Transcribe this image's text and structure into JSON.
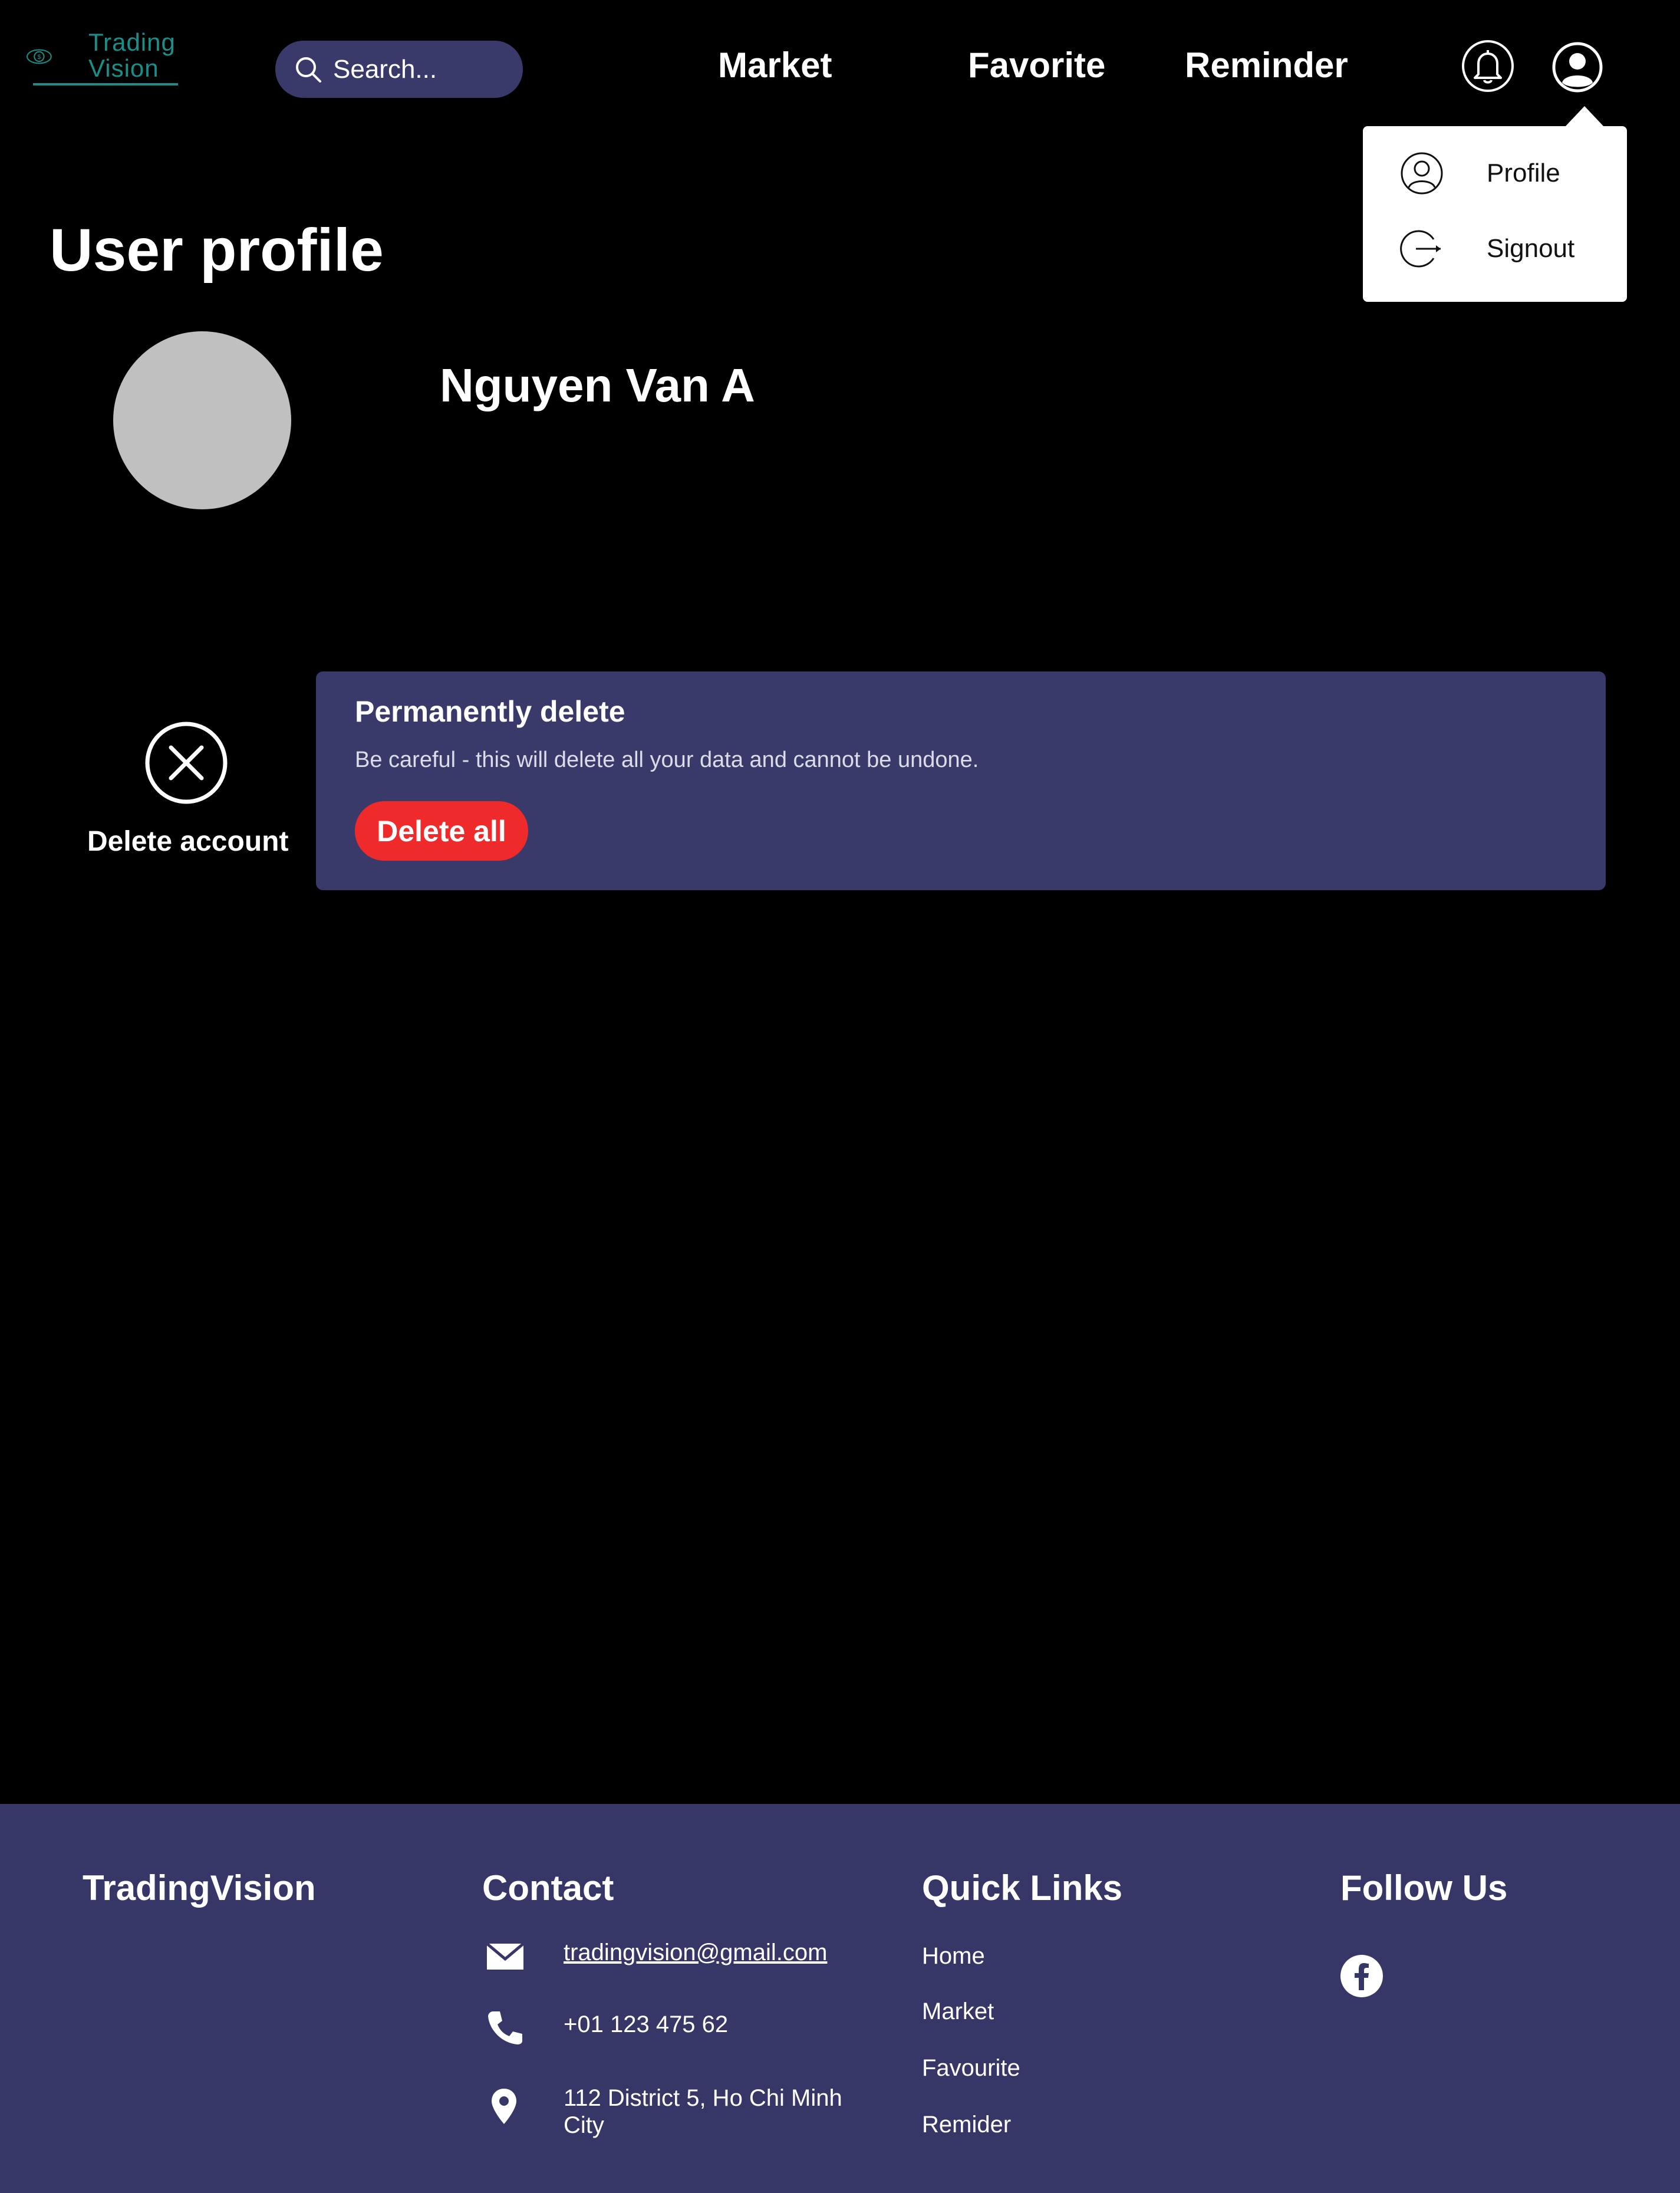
{
  "header": {
    "logo": {
      "line1": "Trading",
      "line2": "Vision"
    },
    "search": {
      "placeholder": "Search..."
    },
    "nav": {
      "market": "Market",
      "favorite": "Favorite",
      "reminder": "Reminder"
    },
    "icons": {
      "notifications": "bell-icon",
      "account": "user-icon"
    }
  },
  "dropdown": {
    "items": [
      {
        "label": "Profile",
        "icon": "user-circle-icon"
      },
      {
        "label": "Signout",
        "icon": "signout-icon"
      }
    ]
  },
  "profile": {
    "title": "User profile",
    "name": "Nguyen Van A"
  },
  "delete_account": {
    "label": "Delete account",
    "card_title": "Permanently delete",
    "warning": "Be careful - this will delete all your data and cannot be undone.",
    "button": "Delete all"
  },
  "footer": {
    "brand": "TradingVision",
    "contact": {
      "heading": "Contact",
      "email": "tradingvision@gmail.com",
      "phone": "+01 123 475 62",
      "address": "112 District 5, Ho Chi Minh City"
    },
    "quick_links": {
      "heading": "Quick Links",
      "items": [
        "Home",
        "Market",
        "Favourite",
        "Remider"
      ]
    },
    "follow": {
      "heading": "Follow Us",
      "icon": "facebook-icon"
    }
  },
  "colors": {
    "background": "#000000",
    "accent": "#3a3a6a",
    "footer": "#373767",
    "danger": "#ee2a2a",
    "logo": "#1a8f8a"
  }
}
